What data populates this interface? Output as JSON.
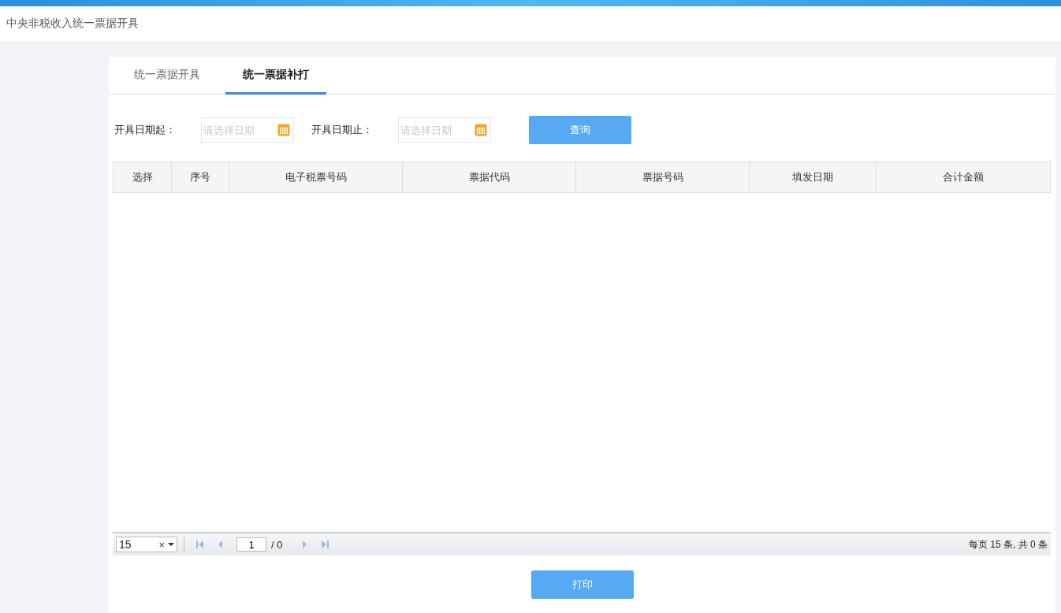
{
  "header": {
    "title": "中央非税收入统一票据开具"
  },
  "tabs": [
    {
      "label": "统一票据开具",
      "selected": false
    },
    {
      "label": "统一票据补打",
      "selected": true
    }
  ],
  "filters": [
    {
      "label": "开具日期起：",
      "placeholder": "请选择日期"
    },
    {
      "label": "开具日期止：",
      "placeholder": "请选择日期"
    }
  ],
  "query_button": "查询",
  "table": {
    "columns": [
      "选择",
      "序号",
      "电子税票号码",
      "票据代码",
      "票据号码",
      "填发日期",
      "合计金额"
    ]
  },
  "pager": {
    "page_size": "15",
    "clear": "×",
    "page": "1",
    "total_pages": "/ 0",
    "summary": "每页 15 条, 共 0 条"
  },
  "print_button": "打印"
}
